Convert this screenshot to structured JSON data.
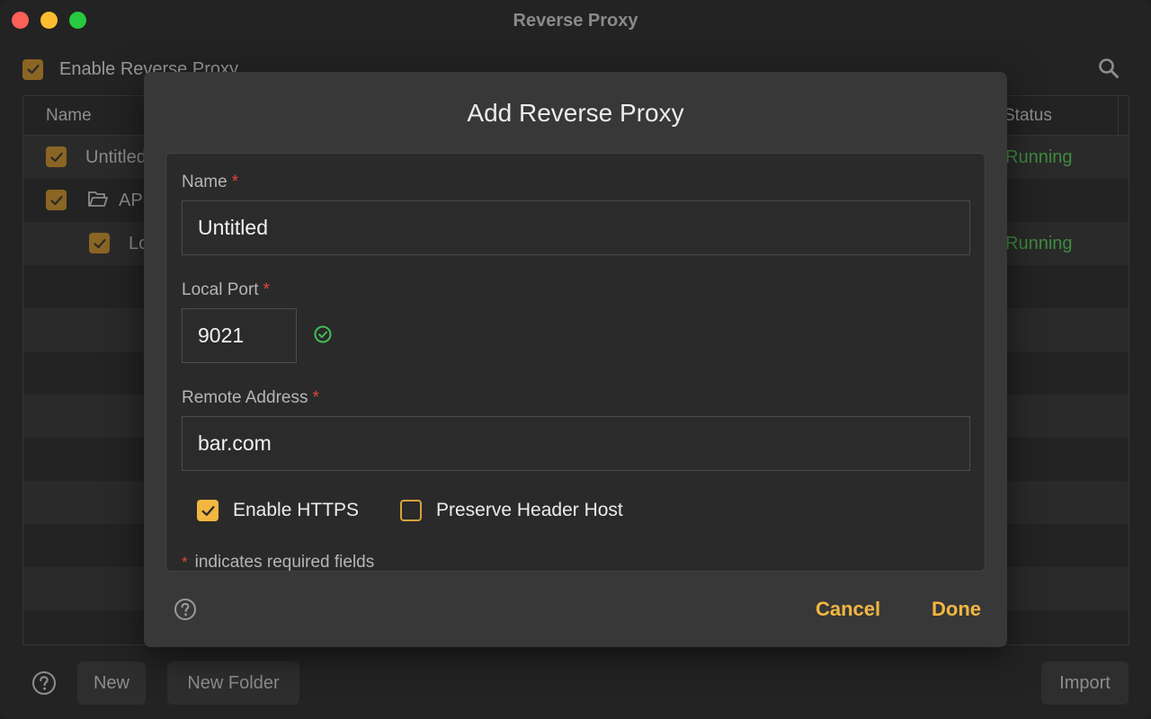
{
  "window": {
    "title": "Reverse Proxy"
  },
  "toolbar": {
    "enable_label": "Enable Reverse Proxy",
    "search_icon": "search-icon"
  },
  "table": {
    "columns": {
      "name": "Name",
      "status": "Status"
    },
    "rows": [
      {
        "name": "Untitled",
        "status": "Running",
        "checked": true
      },
      {
        "name": "API",
        "status": "",
        "checked": true,
        "folder": true
      },
      {
        "name": "Local",
        "status": "Running",
        "checked": true
      }
    ]
  },
  "bottom": {
    "new_label": "New",
    "new_folder_label": "New Folder",
    "import_label": "Import"
  },
  "dialog": {
    "title": "Add Reverse Proxy",
    "name_label": "Name",
    "name_value": "Untitled",
    "port_label": "Local Port",
    "port_value": "9021",
    "remote_label": "Remote Address",
    "remote_value": "bar.com",
    "required_star": "*",
    "enable_https_label": "Enable HTTPS",
    "enable_https_checked": true,
    "preserve_host_label": "Preserve Header Host",
    "preserve_host_checked": false,
    "required_note": "indicates required fields",
    "cancel_label": "Cancel",
    "done_label": "Done"
  },
  "colors": {
    "accent": "#f2b740",
    "required": "#e2473d",
    "ok": "#3fbf5a",
    "running": "#3f8b3f"
  }
}
